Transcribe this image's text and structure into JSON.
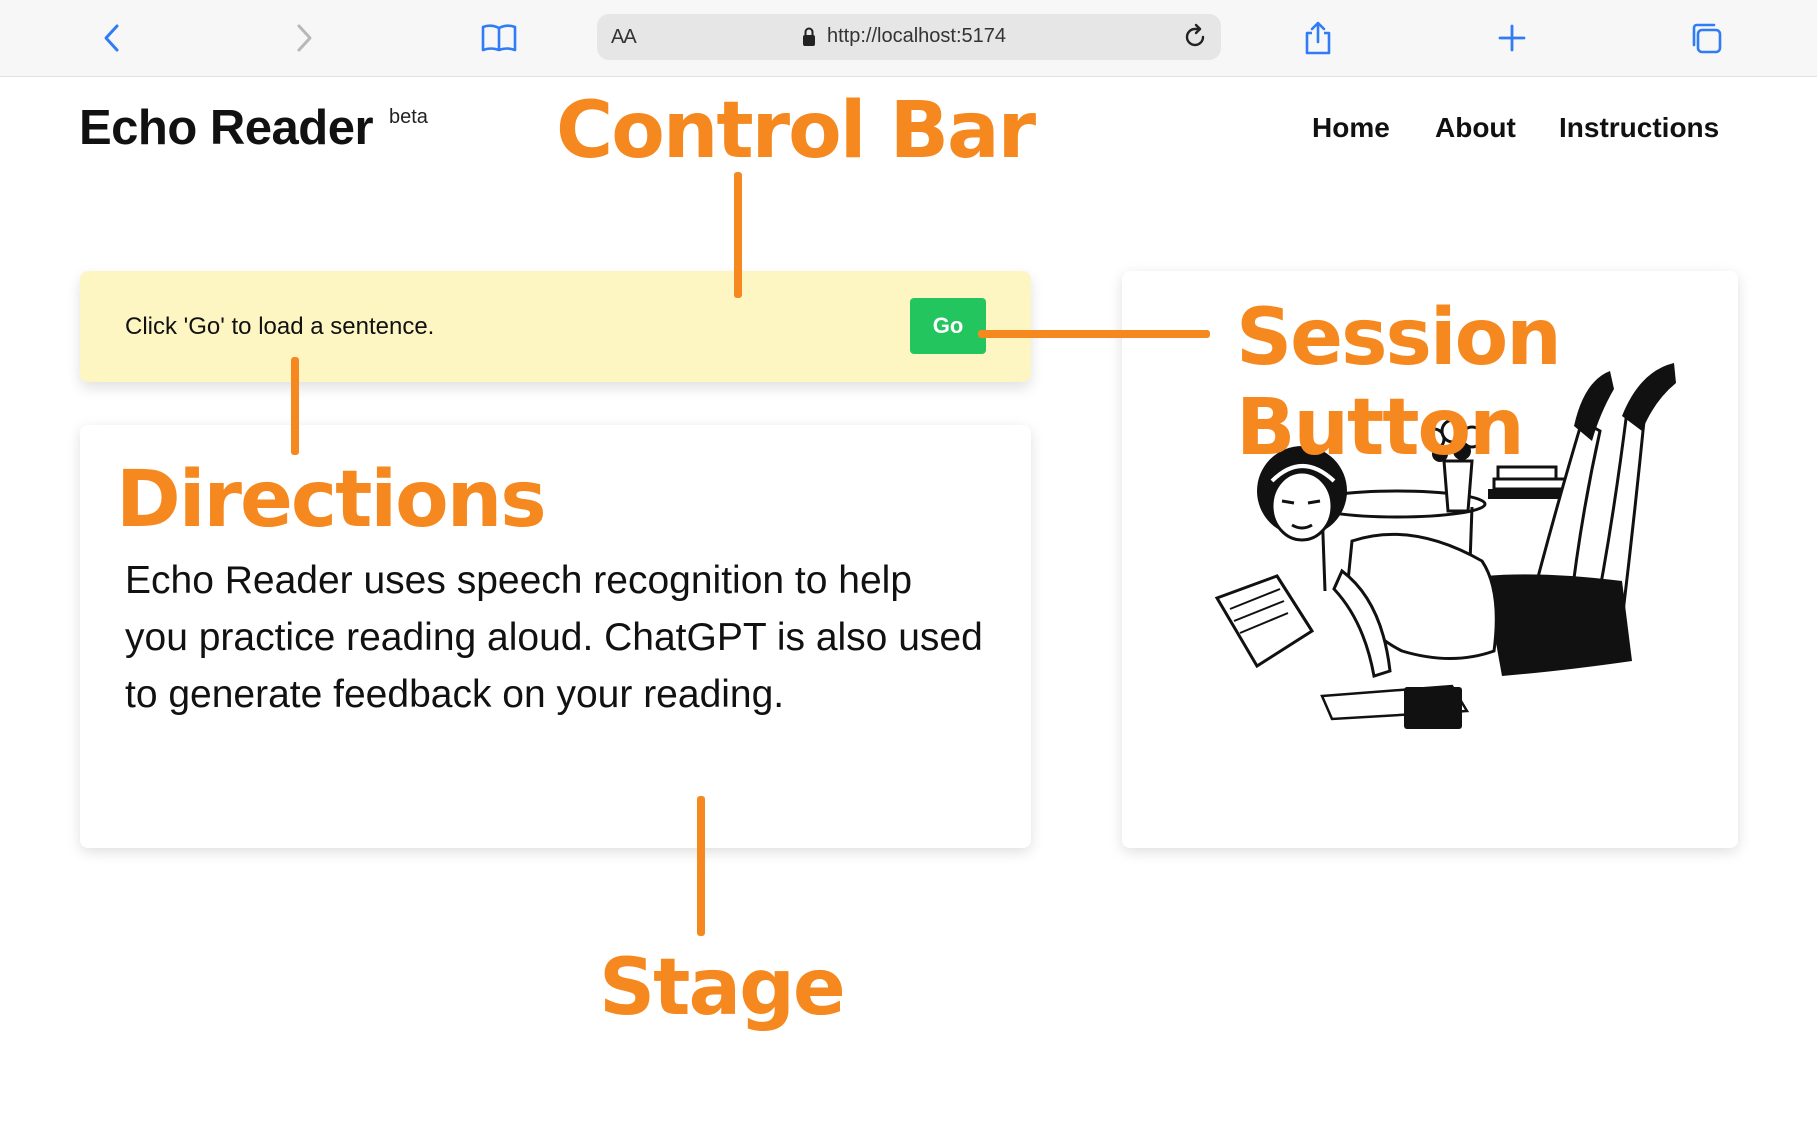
{
  "browser": {
    "text_size_label": "AA",
    "url": "http://localhost:5174",
    "icons": [
      "back-chevron-icon",
      "forward-chevron-icon",
      "book-icon",
      "lock-icon",
      "reload-icon",
      "share-icon",
      "plus-icon",
      "tabs-icon"
    ]
  },
  "header": {
    "brand": "Echo Reader",
    "badge": "beta",
    "nav": [
      "Home",
      "About",
      "Instructions"
    ]
  },
  "control_bar": {
    "hint": "Click 'Go' to load a sentence.",
    "go_label": "Go"
  },
  "stage": {
    "text": "Echo Reader uses speech recognition to help you practice reading aloud. ChatGPT is also used to generate feedback on your reading."
  },
  "annotations": {
    "control_bar": "Control Bar",
    "session_button": "Session Button",
    "directions": "Directions",
    "stage": "Stage"
  },
  "colors": {
    "annotation": "#f5891f",
    "go_button": "#22c55e",
    "control_bar_bg": "#fdf6c3"
  }
}
